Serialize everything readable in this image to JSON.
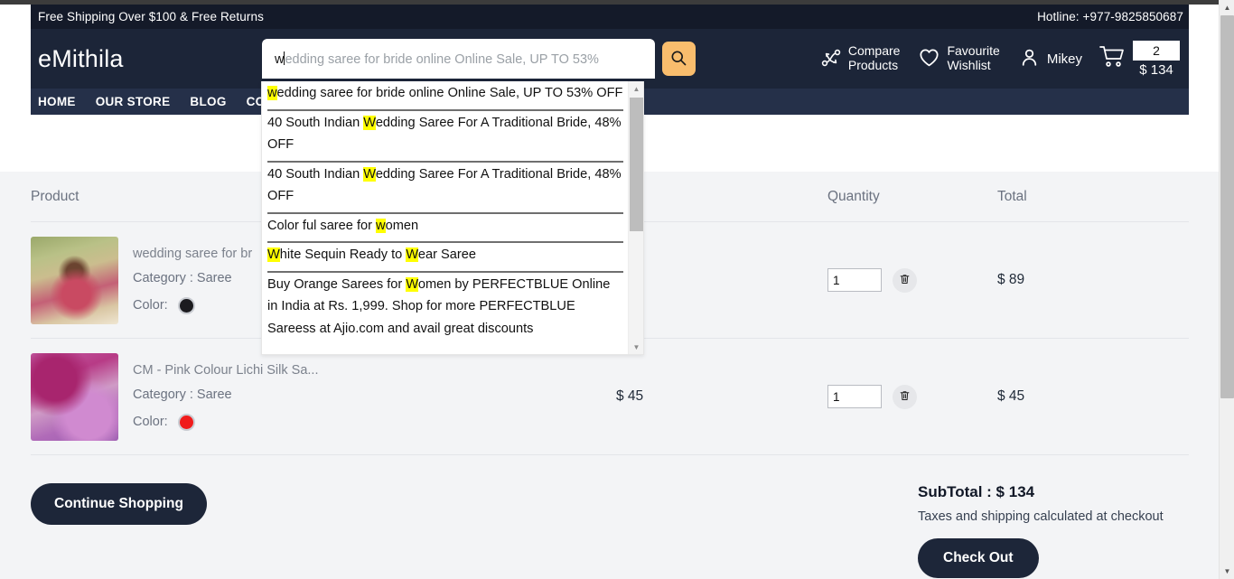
{
  "topbar": {
    "promo": "Free Shipping Over $100 & Free Returns",
    "hotline": "Hotline: +977-9825850687"
  },
  "header": {
    "brand": "eMithila",
    "search": {
      "typed_value": "w",
      "ghost_text": "edding saree for bride online Online Sale, UP TO 53%",
      "button_icon": "search-icon",
      "button_color": "#f9bd6d"
    },
    "compare": {
      "line1": "Compare",
      "line2": "Products",
      "icon": "compare-icon"
    },
    "wishlist": {
      "line1": "Favourite",
      "line2": "Wishlist",
      "icon": "heart-icon"
    },
    "account": {
      "name": "Mikey",
      "icon": "user-icon"
    },
    "cart": {
      "icon": "cart-icon",
      "count": "2",
      "total": "$ 134"
    }
  },
  "nav": {
    "items": [
      {
        "label": "HOME"
      },
      {
        "label": "OUR STORE"
      },
      {
        "label": "BLOG"
      },
      {
        "label": "CON"
      }
    ]
  },
  "autocomplete": {
    "visible": true,
    "highlight_color": "#ffff00",
    "items": [
      {
        "pre": "",
        "hl": "w",
        "post": "edding saree for bride online Online Sale, UP TO 53% OFF"
      },
      {
        "pre": "40 South Indian ",
        "hl": "W",
        "post": "edding Saree For A Traditional Bride, 48% OFF"
      },
      {
        "pre": "40 South Indian ",
        "hl": "W",
        "post": "edding Saree For A Traditional Bride, 48% OFF"
      },
      {
        "pre": "Color ful saree for ",
        "hl": "w",
        "post": "omen"
      },
      {
        "pre": "",
        "hl": "W",
        "post": "hite Sequin Ready to ",
        "hl2": "W",
        "post2": "ear Saree"
      },
      {
        "pre": "Buy Orange Sarees for ",
        "hl": "W",
        "post": "omen by PERFECTBLUE Online in India at Rs. 1,999. Shop for more PERFECTBLUE Sareess at Ajio.com and avail great discounts"
      }
    ]
  },
  "cart": {
    "columns": {
      "product": "Product",
      "price": "",
      "quantity": "Quantity",
      "total": "Total"
    },
    "rows": [
      {
        "title": "wedding saree for br",
        "category": "Category : Saree",
        "color_label": "Color:",
        "color_value": "#1b1b1f",
        "price": "",
        "quantity": "1",
        "total": "$ 89",
        "delete_icon": "trash-icon"
      },
      {
        "title": "CM - Pink Colour Lichi Silk Sa...",
        "category": "Category : Saree",
        "color_label": "Color:",
        "color_value": "#f01b1b",
        "price": "$ 45",
        "quantity": "1",
        "total": "$ 45",
        "delete_icon": "trash-icon"
      }
    ]
  },
  "footer": {
    "continue_shopping": "Continue Shopping",
    "subtotal": "SubTotal : $ 134",
    "tax_note": "Taxes and shipping calculated at checkout",
    "checkout": "Check Out"
  }
}
